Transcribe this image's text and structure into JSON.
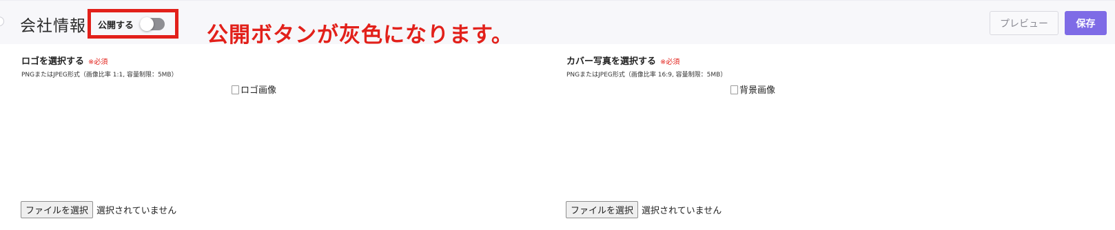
{
  "header": {
    "title": "会社情報",
    "publish_label": "公開する",
    "publish_toggle_on": false,
    "annotation": "公開ボタンが灰色になります。",
    "preview_label": "プレビュー",
    "save_label": "保存"
  },
  "logo_section": {
    "title": "ロゴを選択する",
    "required": "※必須",
    "hint": "PNGまたはJPEG形式（画像比率 1:1, 容量制限：5MB）",
    "image_alt": "ロゴ画像",
    "file_button": "ファイルを選択",
    "file_status": "選択されていません"
  },
  "cover_section": {
    "title": "カバー写真を選択する",
    "required": "※必須",
    "hint": "PNGまたはJPEG形式（画像比率 16:9, 容量制限：5MB）",
    "image_alt": "背景画像",
    "file_button": "ファイルを選択",
    "file_status": "選択されていません"
  },
  "colors": {
    "accent": "#7e6be6",
    "annotation": "#e2201a",
    "toggle_off": "#8e8e93"
  }
}
